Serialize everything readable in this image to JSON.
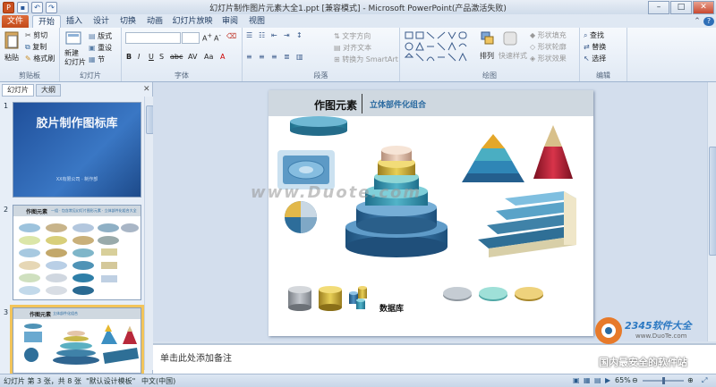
{
  "window": {
    "title": "幻灯片制作图片元素大全1.ppt [兼容模式] - Microsoft PowerPoint(产品激活失败)"
  },
  "ribbon_tabs": [
    "文件",
    "开始",
    "插入",
    "设计",
    "切换",
    "动画",
    "幻灯片放映",
    "审阅",
    "视图"
  ],
  "ribbon": {
    "clipboard": {
      "paste": "粘贴",
      "cut": "剪切",
      "copy": "复制",
      "format_painter": "格式刷",
      "label": "剪贴板"
    },
    "slides": {
      "new_slide": "新建\n幻灯片",
      "layout": "版式",
      "reset": "重设",
      "section": "节",
      "label": "幻灯片"
    },
    "font": {
      "label": "字体"
    },
    "paragraph": {
      "text_direction": "文字方向",
      "align_text": "对齐文本",
      "convert_smartart": "转换为 SmartArt",
      "label": "段落"
    },
    "drawing": {
      "arrange": "排列",
      "quick_styles": "快速样式",
      "shape_fill": "形状填充",
      "shape_outline": "形状轮廓",
      "shape_effects": "形状效果",
      "label": "绘图"
    },
    "editing": {
      "find": "查找",
      "replace": "替换",
      "select": "选择",
      "label": "编辑"
    }
  },
  "left_pane": {
    "tabs": [
      "幻灯片",
      "大纲"
    ],
    "thumbs": [
      {
        "num": "1",
        "title": "胶片制作图标库",
        "subtitle": "XX有限公司 · 制作部"
      },
      {
        "num": "2",
        "title": "作图元素",
        "subtitle": "一组 · 包含常见幻灯片图形元素 · 立体部件化组合大全"
      },
      {
        "num": "3",
        "title": "作图元素",
        "subtitle": "立体部件化组合"
      }
    ]
  },
  "slide": {
    "title": "作图元素",
    "subtitle": "立体部件化组合",
    "database_label": "数据库",
    "watermark": "www.Duote.com"
  },
  "notes": {
    "placeholder": "单击此处添加备注"
  },
  "status": {
    "slide_info": "幻灯片 第 3 张，共 8 张",
    "theme": "\"默认设计模板\"",
    "language": "中文(中国)",
    "zoom": "65%"
  },
  "brand": {
    "name": "2345软件大全",
    "site": "www.DuoTe.com",
    "slogan": "国内最安全的软件站"
  },
  "colors": {
    "file_tab": "#c9501f",
    "slide_head": "#cfd8e0",
    "accent_blue": "#2a6aa0"
  }
}
